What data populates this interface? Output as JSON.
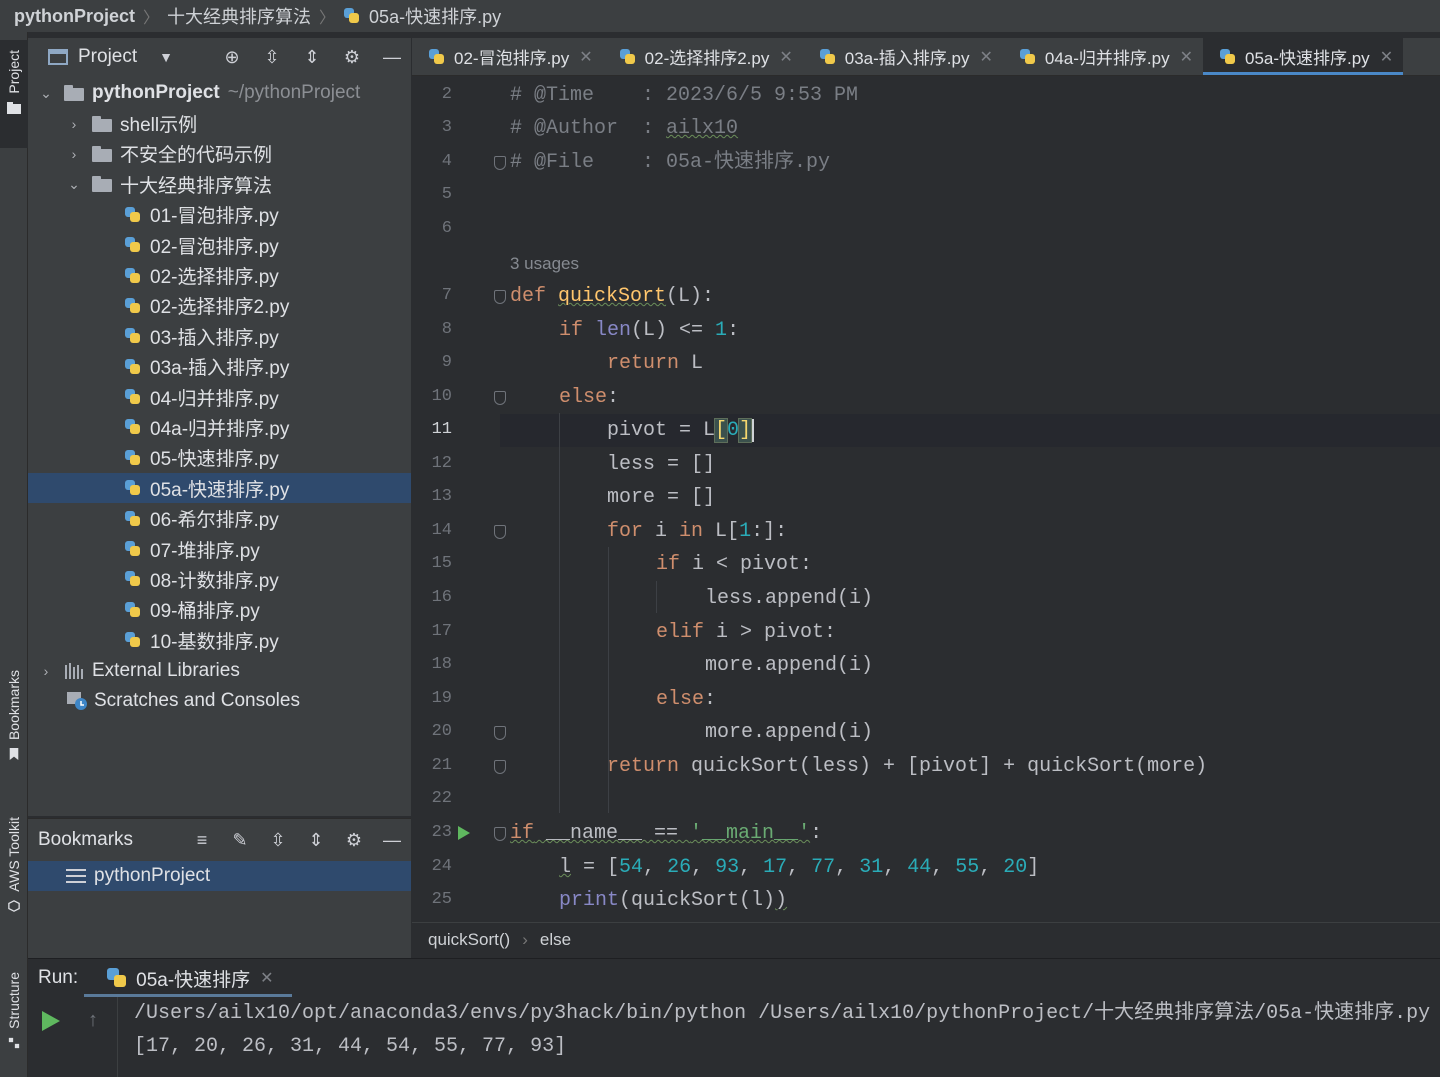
{
  "breadcrumb": [
    "pythonProject",
    "十大经典排序算法",
    "05a-快速排序.py"
  ],
  "left_strip": {
    "project": "Project",
    "bookmarks": "Bookmarks",
    "aws": "AWS Toolkit",
    "structure": "Structure"
  },
  "project_panel": {
    "title": "Project",
    "root": {
      "label": "pythonProject",
      "hint": "~/pythonProject"
    },
    "folders": [
      "shell示例",
      "不安全的代码示例",
      "十大经典排序算法"
    ],
    "files": [
      "01-冒泡排序.py",
      "02-冒泡排序.py",
      "02-选择排序.py",
      "02-选择排序2.py",
      "03-插入排序.py",
      "03a-插入排序.py",
      "04-归并排序.py",
      "04a-归并排序.py",
      "05-快速排序.py",
      "05a-快速排序.py",
      "06-希尔排序.py",
      "07-堆排序.py",
      "08-计数排序.py",
      "09-桶排序.py",
      "10-基数排序.py"
    ],
    "external_libraries": "External Libraries",
    "scratches": "Scratches and Consoles"
  },
  "bookmarks_panel": {
    "title": "Bookmarks",
    "item": "pythonProject"
  },
  "editor_tabs": [
    "02-冒泡排序.py",
    "02-选择排序2.py",
    "03a-插入排序.py",
    "04a-归并排序.py",
    "05a-快速排序.py"
  ],
  "editor": {
    "line_numbers": [
      "2",
      "3",
      "4",
      "5",
      "6",
      "7",
      "8",
      "9",
      "10",
      "11",
      "12",
      "13",
      "14",
      "15",
      "16",
      "17",
      "18",
      "19",
      "20",
      "21",
      "22",
      "23",
      "24",
      "25"
    ],
    "current_line": "11",
    "usages_hint": "3 usages",
    "code": {
      "l2_a": "# @Time    : 2023/6/5 9:53 PM",
      "l3_a": "# @Author  : ",
      "l3_b": "ailx10",
      "l4_a": "# @File    : 05a-快速排序.py",
      "l7_kw": "def ",
      "l7_name": "quickSort",
      "l7_rest": "(L):",
      "l8_kw": "if ",
      "l8_fn": "len",
      "l8_mid": "(L) <= ",
      "l8_num": "1",
      "l8_end": ":",
      "l9_kw": "return",
      "l9_rest": " L",
      "l10_kw": "else",
      "l10_rest": ":",
      "l11_a": "pivot = L",
      "l11_b": "[",
      "l11_c": "0",
      "l11_d": "]",
      "l12": "less = []",
      "l13": "more = []",
      "l14_kw1": "for",
      "l14_mid": " i ",
      "l14_kw2": "in",
      "l14_b": " L[",
      "l14_num": "1",
      "l14_end": ":]:",
      "l15_kw": "if",
      "l15_rest": " i < pivot:",
      "l16": "less.append(i)",
      "l17_kw": "elif",
      "l17_rest": " i > pivot:",
      "l18": "more.append(i)",
      "l19_kw": "else",
      "l19_rest": ":",
      "l20": "more.append(i)",
      "l21_kw": "return",
      "l21_rest": " quickSort(less) + [pivot] + quickSort(more)",
      "l23_kw": "if",
      "l23_mid": " __name__ == ",
      "l23_str": "'__main__'",
      "l23_end": ":",
      "l24_a": "l",
      "l24_b": " = [",
      "l24_nums": [
        "54",
        "26",
        "93",
        "17",
        "77",
        "31",
        "44",
        "55",
        "20"
      ],
      "l24_end": "]",
      "l25_fn": "print",
      "l25_rest": "(quickSort(l)",
      "l25_end": ")"
    }
  },
  "editor_breadcrumb": [
    "quickSort()",
    "else"
  ],
  "run_panel": {
    "label": "Run:",
    "tab": "05a-快速排序",
    "output": [
      "/Users/ailx10/opt/anaconda3/envs/py3hack/bin/python /Users/ailx10/pythonProject/十大经典排序算法/05a-快速排序.py",
      "[17, 20, 26, 31, 44, 54, 55, 77, 93]"
    ]
  },
  "colors": {
    "selection": "#2f4a6d",
    "keyword": "#cf8e6d",
    "number": "#2aacb8",
    "string": "#6aab73",
    "comment": "#7a7e85",
    "function": "#56a8f5",
    "tab_accent": "#4a88c7"
  }
}
